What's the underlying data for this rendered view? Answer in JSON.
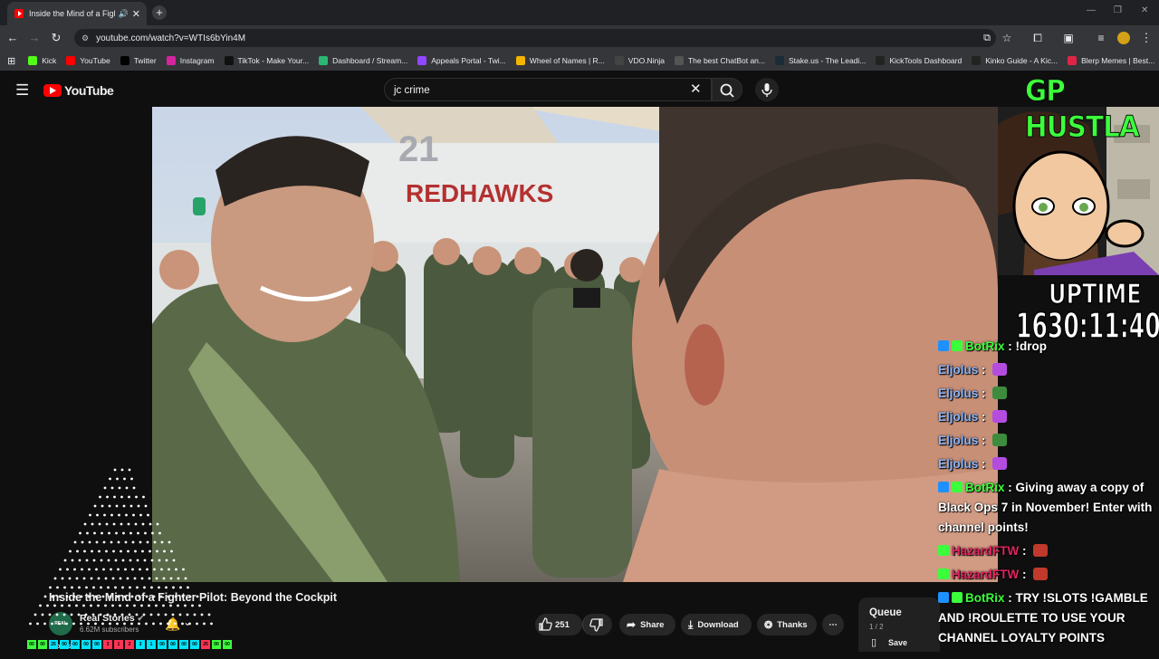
{
  "browser": {
    "tab_title": "Inside the Mind of a Fighte",
    "url": "youtube.com/watch?v=WTIs6bYin4M",
    "bookmarks": [
      {
        "label": "Kick",
        "color": "#53fc18"
      },
      {
        "label": "YouTube",
        "color": "#ff0000"
      },
      {
        "label": "Twitter",
        "color": "#000000"
      },
      {
        "label": "Instagram",
        "color": "#d6249f"
      },
      {
        "label": "TikTok - Make Your...",
        "color": "#111111"
      },
      {
        "label": "Dashboard / Stream...",
        "color": "#2bb673"
      },
      {
        "label": "Appeals Portal - Twi...",
        "color": "#9146ff"
      },
      {
        "label": "Wheel of Names | R...",
        "color": "#f4b400"
      },
      {
        "label": "VDO.Ninja",
        "color": "#444444"
      },
      {
        "label": "The best ChatBot an...",
        "color": "#555555"
      },
      {
        "label": "Stake.us - The Leadi...",
        "color": "#1a2c38"
      },
      {
        "label": "KickTools Dashboard",
        "color": "#222222"
      },
      {
        "label": "Kinko Guide - A Kic...",
        "color": "#222222"
      },
      {
        "label": "Blerp Memes | Best...",
        "color": "#e02447"
      }
    ]
  },
  "youtube": {
    "logo_text": "YouTube",
    "search_query": "jc crime",
    "video_title": "Inside the Mind of a Fighter Pilot: Beyond the Cockpit",
    "channel_name": "Real Stories",
    "channel_avatar_text": "REAL STORIES",
    "subscribers": "6.62M subscribers",
    "likes": "251",
    "share_label": "Share",
    "download_label": "Download",
    "thanks_label": "Thanks",
    "queue_label": "Queue",
    "queue_count": "1 / 2",
    "save_label": "Save",
    "scene_sign": "REDHAWKS",
    "scene_number": "21"
  },
  "overlay": {
    "title": "GP HUSTLA",
    "uptime_label": "UPTIME",
    "uptime_value": "1630:11:40",
    "chat": [
      {
        "name": "BotRix",
        "name_color": "#3cff3c",
        "text": "!drop",
        "badges": [
          "#1e90ff",
          "#3cff3c"
        ],
        "emote": null
      },
      {
        "name": "Eljolus",
        "name_color": "#8ab4f8",
        "text": "",
        "badges": [],
        "emote": "#b44ce0"
      },
      {
        "name": "Eljolus",
        "name_color": "#8ab4f8",
        "text": "",
        "badges": [],
        "emote": "#3d8c3d"
      },
      {
        "name": "Eljolus",
        "name_color": "#8ab4f8",
        "text": "",
        "badges": [],
        "emote": "#b44ce0"
      },
      {
        "name": "Eljolus",
        "name_color": "#8ab4f8",
        "text": "",
        "badges": [],
        "emote": "#3d8c3d"
      },
      {
        "name": "Eljolus",
        "name_color": "#8ab4f8",
        "text": "",
        "badges": [],
        "emote": "#b44ce0"
      },
      {
        "name": "BotRix",
        "name_color": "#3cff3c",
        "text": "Giving away a copy of Black Ops 7 in November! Enter with channel points!",
        "badges": [
          "#1e90ff",
          "#3cff3c"
        ],
        "emote": null
      },
      {
        "name": "HazardFTW",
        "name_color": "#e0245e",
        "text": "",
        "badges": [
          "#3cff3c"
        ],
        "emote": "#c0392b"
      },
      {
        "name": "HazardFTW",
        "name_color": "#e0245e",
        "text": "",
        "badges": [
          "#3cff3c"
        ],
        "emote": "#c0392b"
      },
      {
        "name": "BotRix",
        "name_color": "#3cff3c",
        "text": "TRY !SLOTS !GAMBLE AND !ROULETTE TO USE YOUR CHANNEL LOYALTY POINTS",
        "badges": [
          "#1e90ff",
          "#3cff3c"
        ],
        "emote": null
      }
    ],
    "bottom_numbers": [
      "00",
      "00",
      "25",
      "00",
      "00",
      "00",
      "00",
      "3",
      "1",
      "2",
      "3",
      "1",
      "00",
      "00",
      "00",
      "00",
      "25",
      "00",
      "00"
    ],
    "bottom_colors": [
      "#3cff3c",
      "#3cff3c",
      "#00e5ff",
      "#00e5ff",
      "#00e5ff",
      "#00e5ff",
      "#00e5ff",
      "#ff3355",
      "#ff3355",
      "#ff3355",
      "#00e5ff",
      "#00e5ff",
      "#00e5ff",
      "#00e5ff",
      "#00e5ff",
      "#00e5ff",
      "#ff3355",
      "#3cff3c",
      "#3cff3c"
    ]
  }
}
